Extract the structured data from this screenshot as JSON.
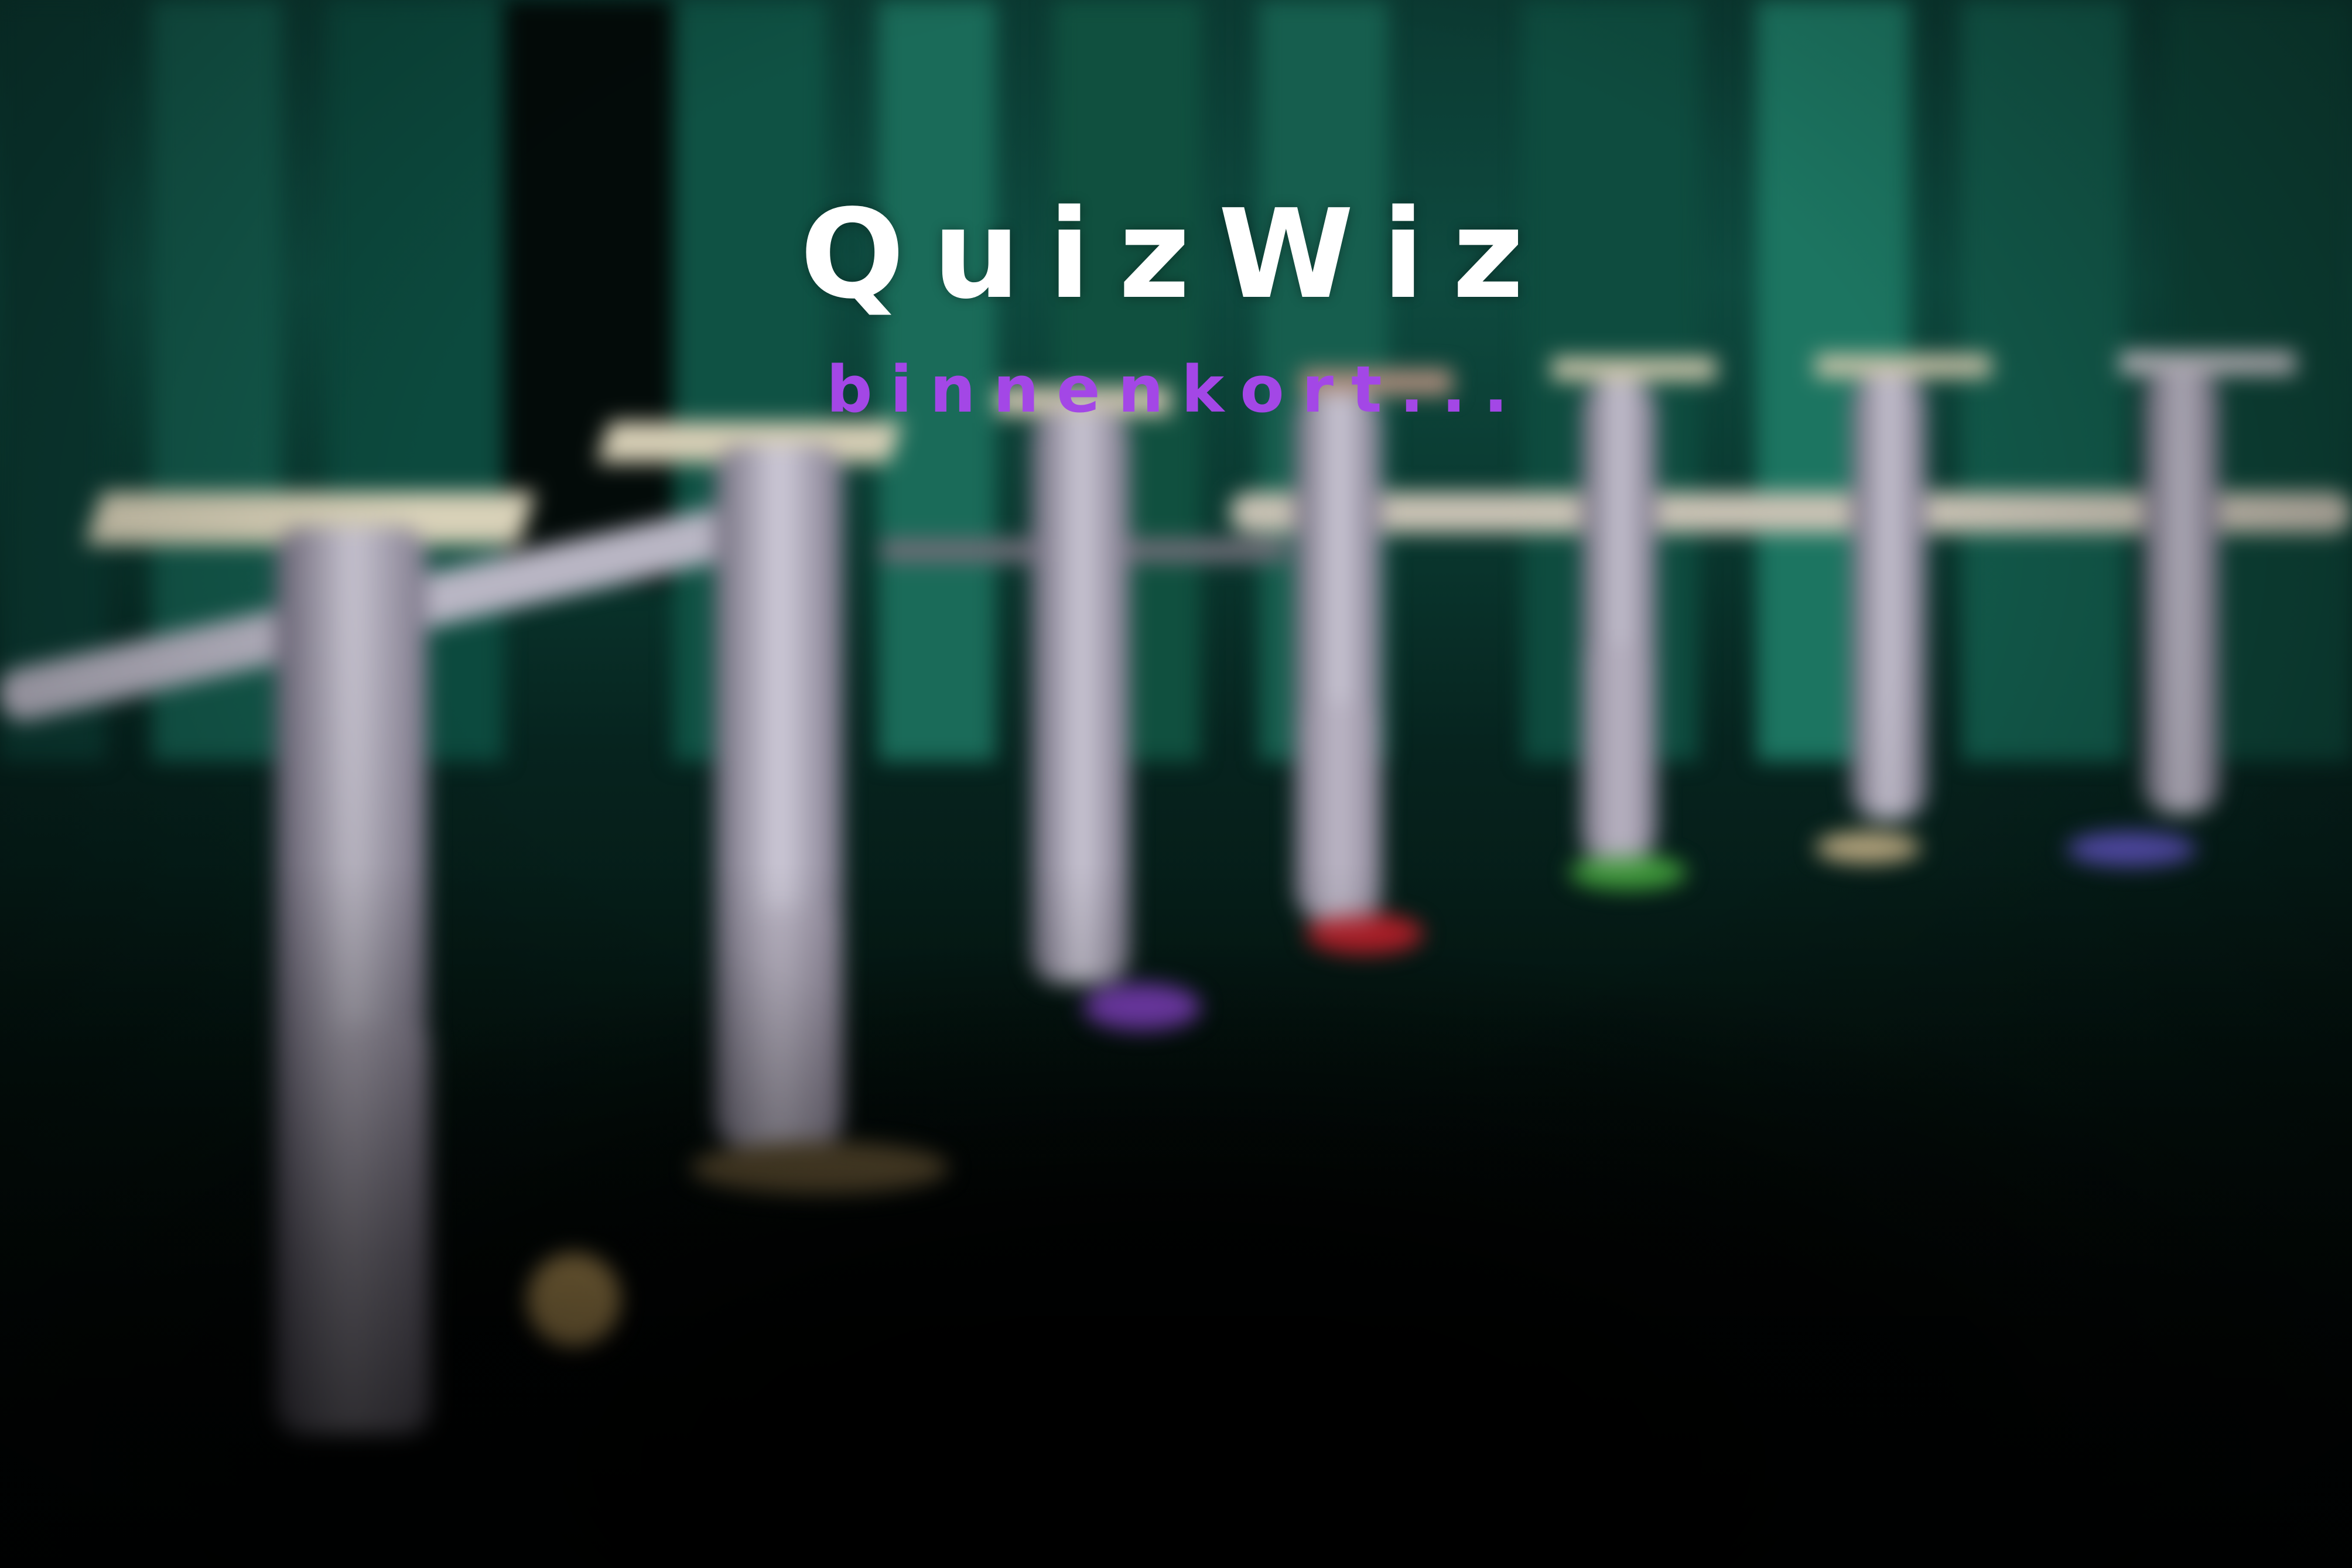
{
  "page": {
    "title": "QuizWiz",
    "subtitle": "binnenkort..."
  },
  "colors": {
    "title": "#ffffff",
    "subtitle": "#a347e6",
    "set_teal": "#0e4a3f",
    "background_dark": "#020807"
  },
  "background": {
    "description_icon": "quiz-studio-set-image"
  }
}
